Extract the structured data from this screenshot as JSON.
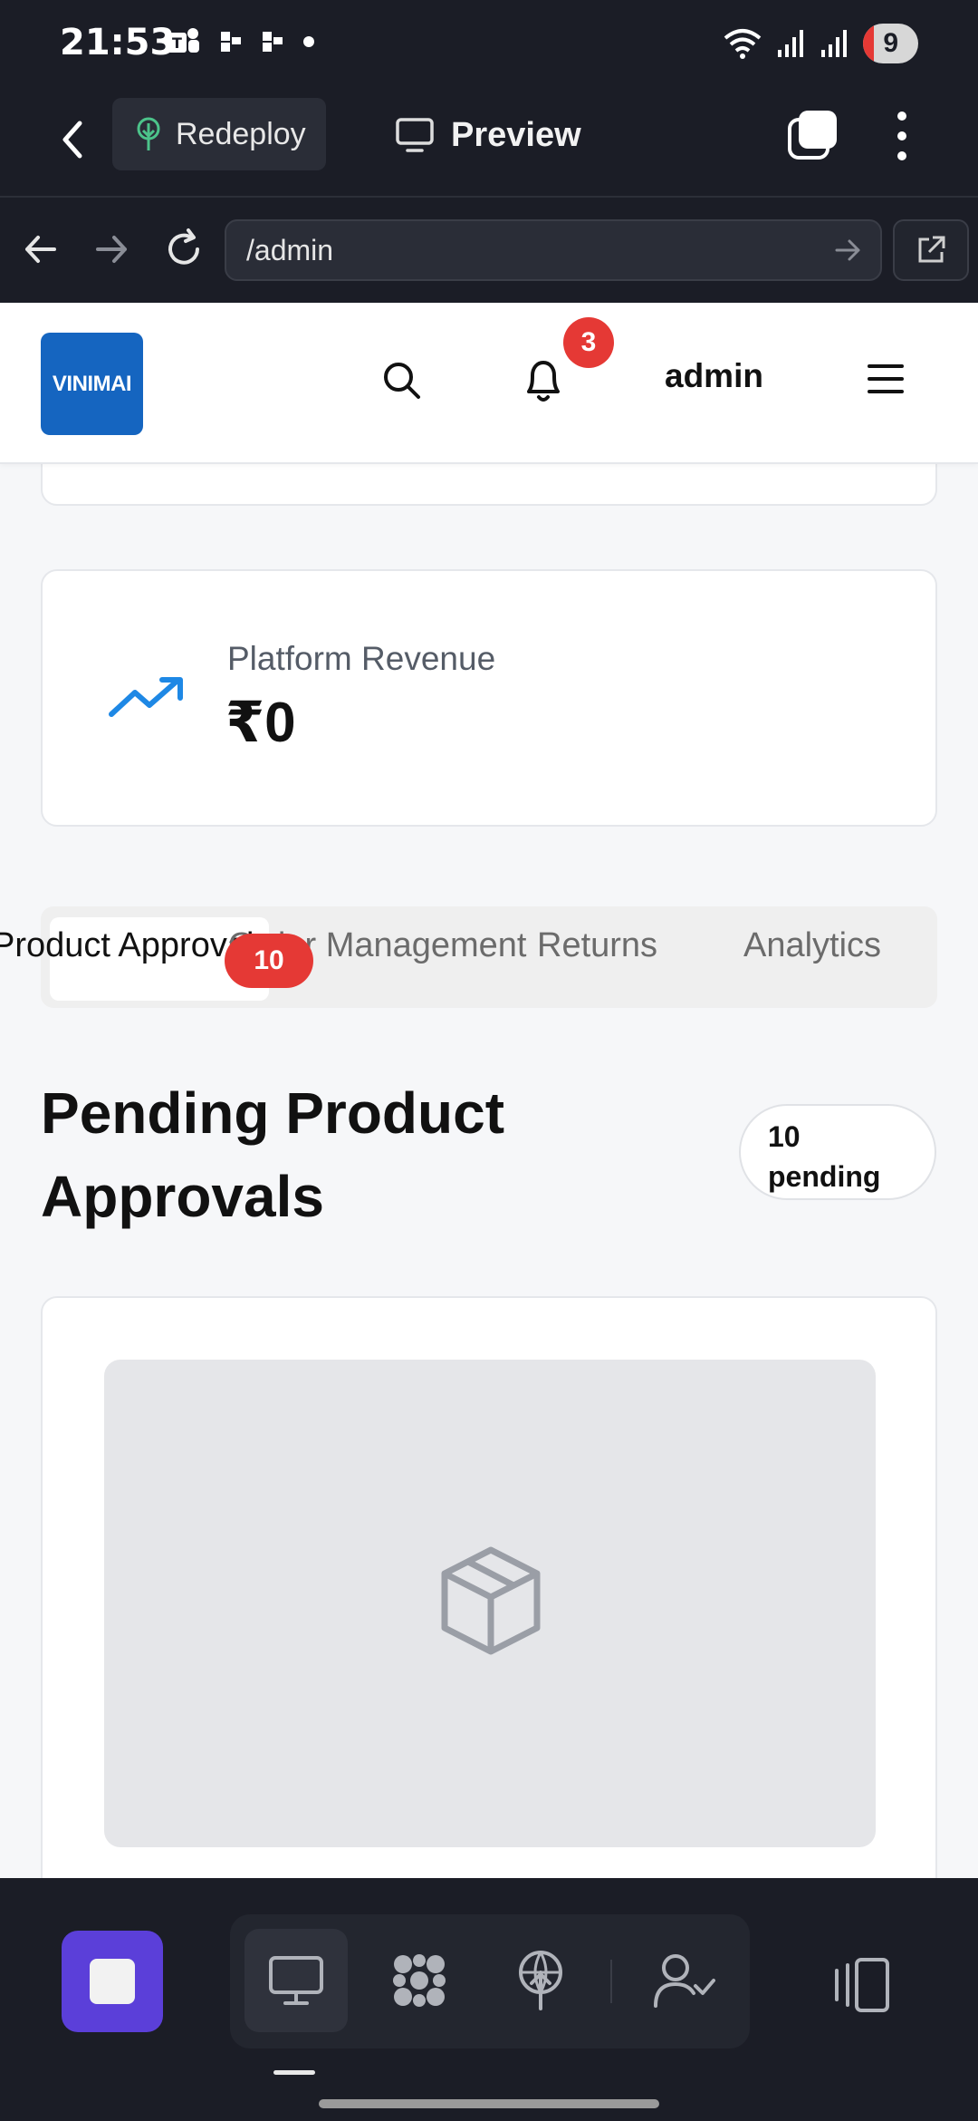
{
  "status_bar": {
    "time": "21:53",
    "battery": "9"
  },
  "app_bar": {
    "redeploy_label": "Redeploy",
    "preview_label": "Preview"
  },
  "url_bar": {
    "value": "/admin"
  },
  "site_header": {
    "logo_text": "VINIMAI",
    "notification_count": "3",
    "username": "admin"
  },
  "revenue_card": {
    "label": "Platform Revenue",
    "value": "₹0"
  },
  "tabs": {
    "items": [
      {
        "label": "Product Approvals"
      },
      {
        "label": "Order Management"
      },
      {
        "label": "Returns"
      },
      {
        "label": "Analytics"
      }
    ],
    "badge": "10"
  },
  "section": {
    "title": "Pending Product Approvals",
    "pending_count": "10",
    "pending_word": "pending"
  },
  "colors": {
    "accent_blue": "#1565c0",
    "badge_red": "#e53935",
    "dock_primary": "#5b3fd9",
    "trend_icon": "#1e88e5"
  },
  "icons": {
    "revenue": "trending-up-icon",
    "product_placeholder": "package-box-icon"
  }
}
